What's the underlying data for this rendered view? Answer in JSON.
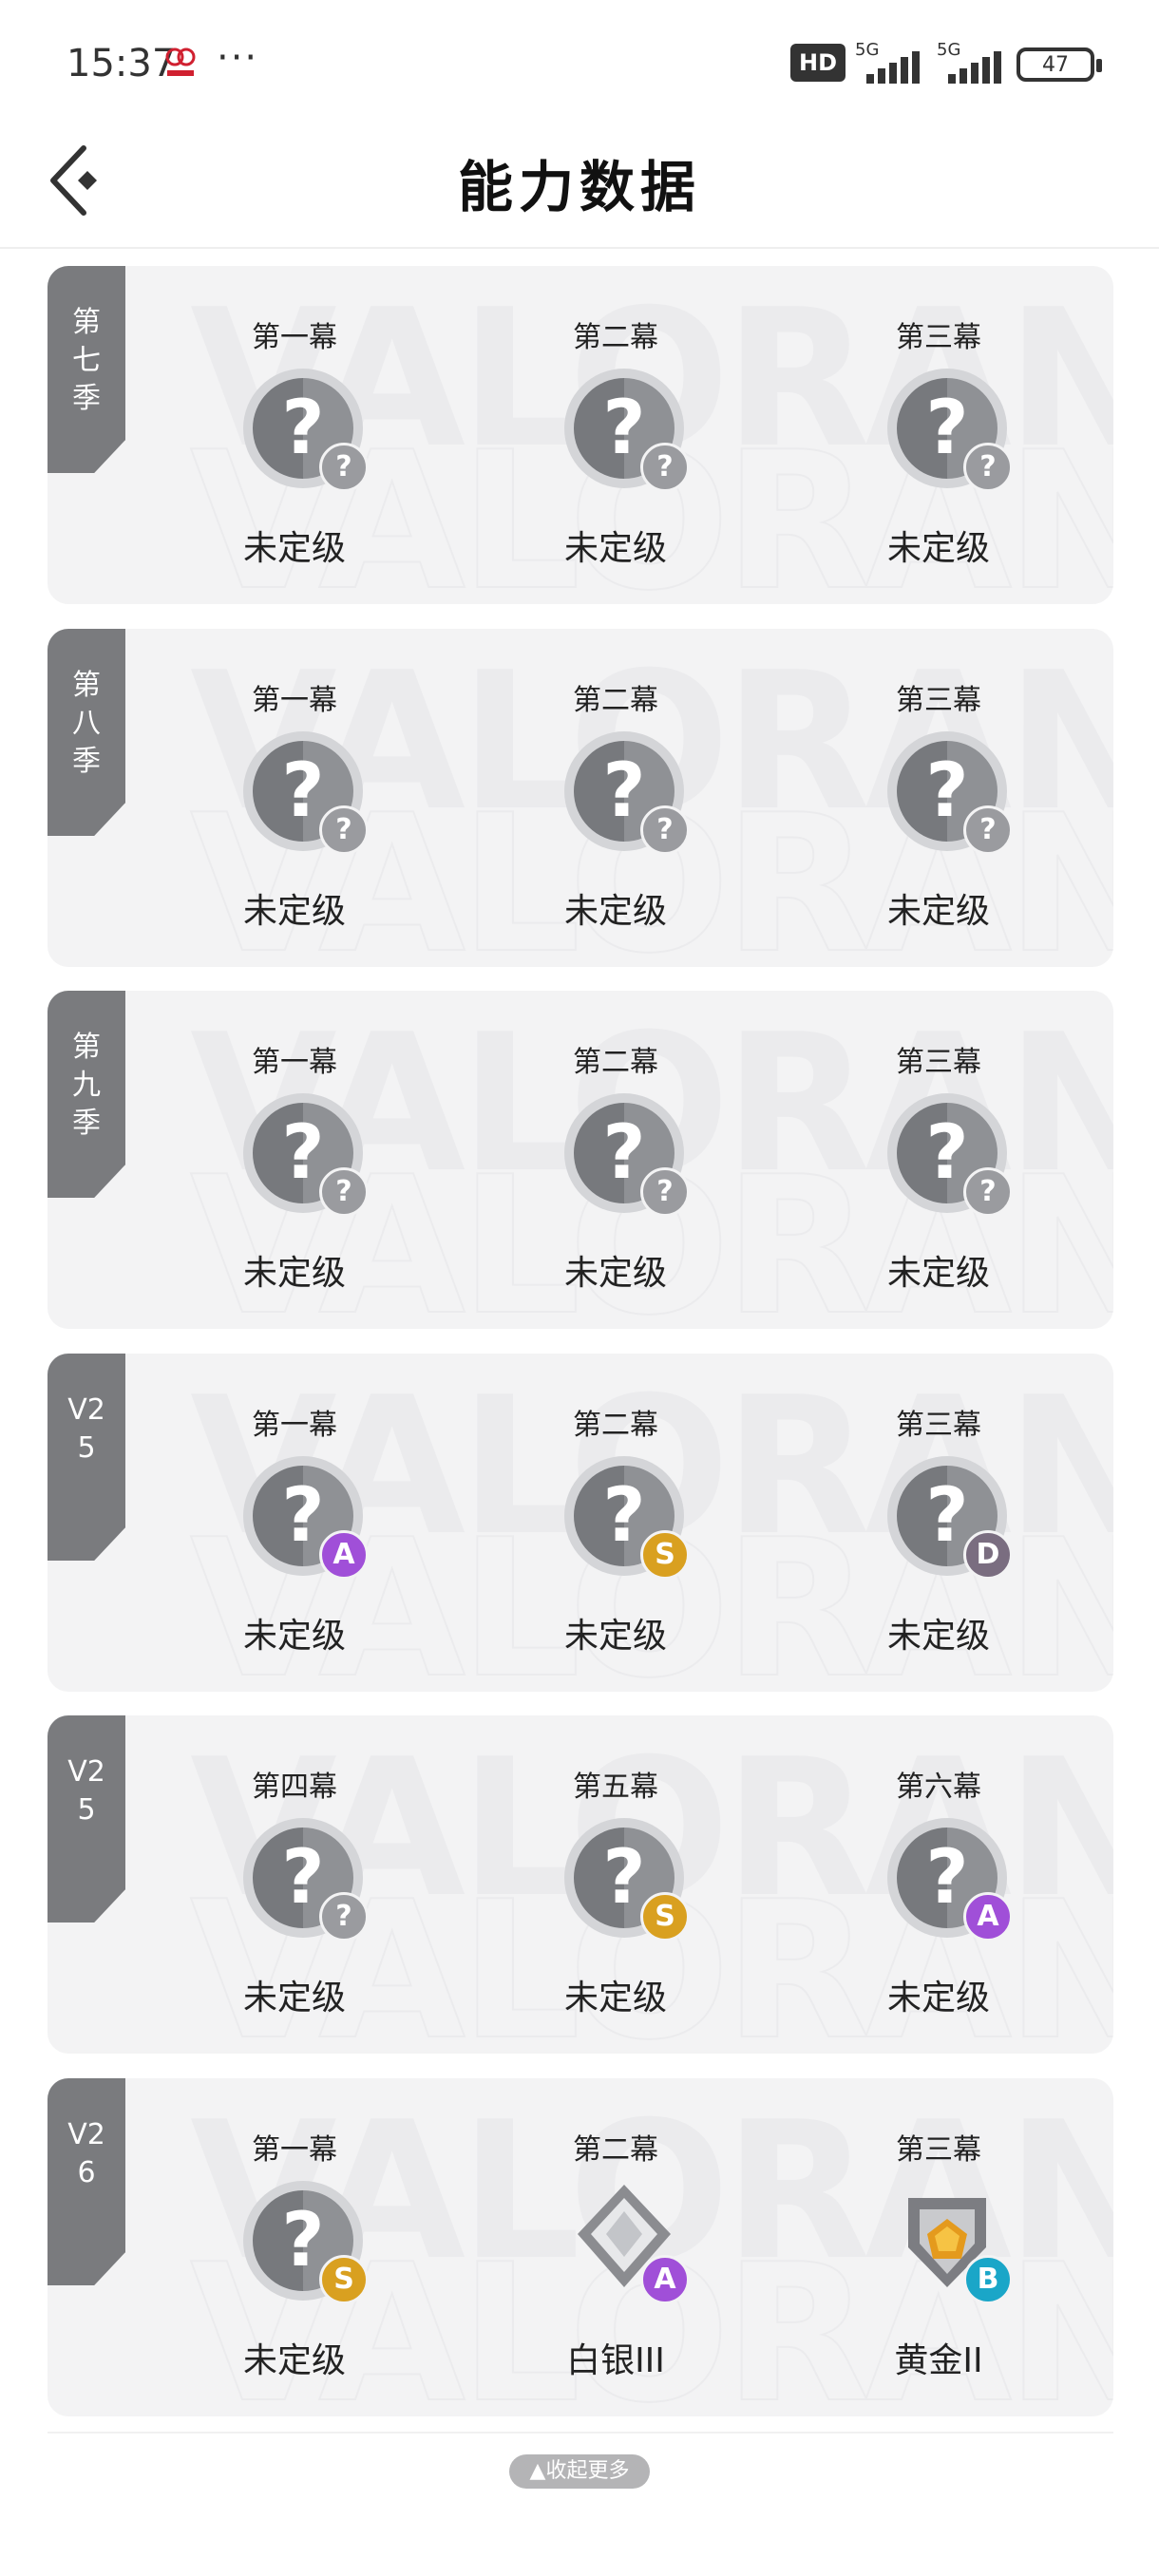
{
  "status": {
    "time": "15:37",
    "dots": "···",
    "hd": "HD",
    "sig1": "5G",
    "sig2": "5G",
    "battery": "47"
  },
  "header": {
    "title": "能力数据"
  },
  "watermark": "VALORANT",
  "cards": [
    {
      "season": "第\n七\n季",
      "cols": [
        {
          "act": "第一幕",
          "rank": "未定级",
          "badge": "?"
        },
        {
          "act": "第二幕",
          "rank": "未定级",
          "badge": "?"
        },
        {
          "act": "第三幕",
          "rank": "未定级",
          "badge": "?"
        }
      ]
    },
    {
      "season": "第\n八\n季",
      "cols": [
        {
          "act": "第一幕",
          "rank": "未定级",
          "badge": "?"
        },
        {
          "act": "第二幕",
          "rank": "未定级",
          "badge": "?"
        },
        {
          "act": "第三幕",
          "rank": "未定级",
          "badge": "?"
        }
      ]
    },
    {
      "season": "第\n九\n季",
      "cols": [
        {
          "act": "第一幕",
          "rank": "未定级",
          "badge": "?"
        },
        {
          "act": "第二幕",
          "rank": "未定级",
          "badge": "?"
        },
        {
          "act": "第三幕",
          "rank": "未定级",
          "badge": "?"
        }
      ]
    },
    {
      "season": "V2\n5",
      "cols": [
        {
          "act": "第一幕",
          "rank": "未定级",
          "badge": "A"
        },
        {
          "act": "第二幕",
          "rank": "未定级",
          "badge": "S"
        },
        {
          "act": "第三幕",
          "rank": "未定级",
          "badge": "D"
        }
      ]
    },
    {
      "season": "V2\n5",
      "cols": [
        {
          "act": "第四幕",
          "rank": "未定级",
          "badge": "?"
        },
        {
          "act": "第五幕",
          "rank": "未定级",
          "badge": "S"
        },
        {
          "act": "第六幕",
          "rank": "未定级",
          "badge": "A"
        }
      ]
    },
    {
      "season": "V2\n6",
      "cols": [
        {
          "act": "第一幕",
          "rank": "未定级",
          "badge": "S"
        },
        {
          "act": "第二幕",
          "rank": "白银III",
          "badge": "A",
          "emblem": "silver"
        },
        {
          "act": "第三幕",
          "rank": "黄金II",
          "badge": "B",
          "emblem": "gold"
        }
      ]
    }
  ],
  "footer": {
    "collapse": "▲收起更多"
  }
}
